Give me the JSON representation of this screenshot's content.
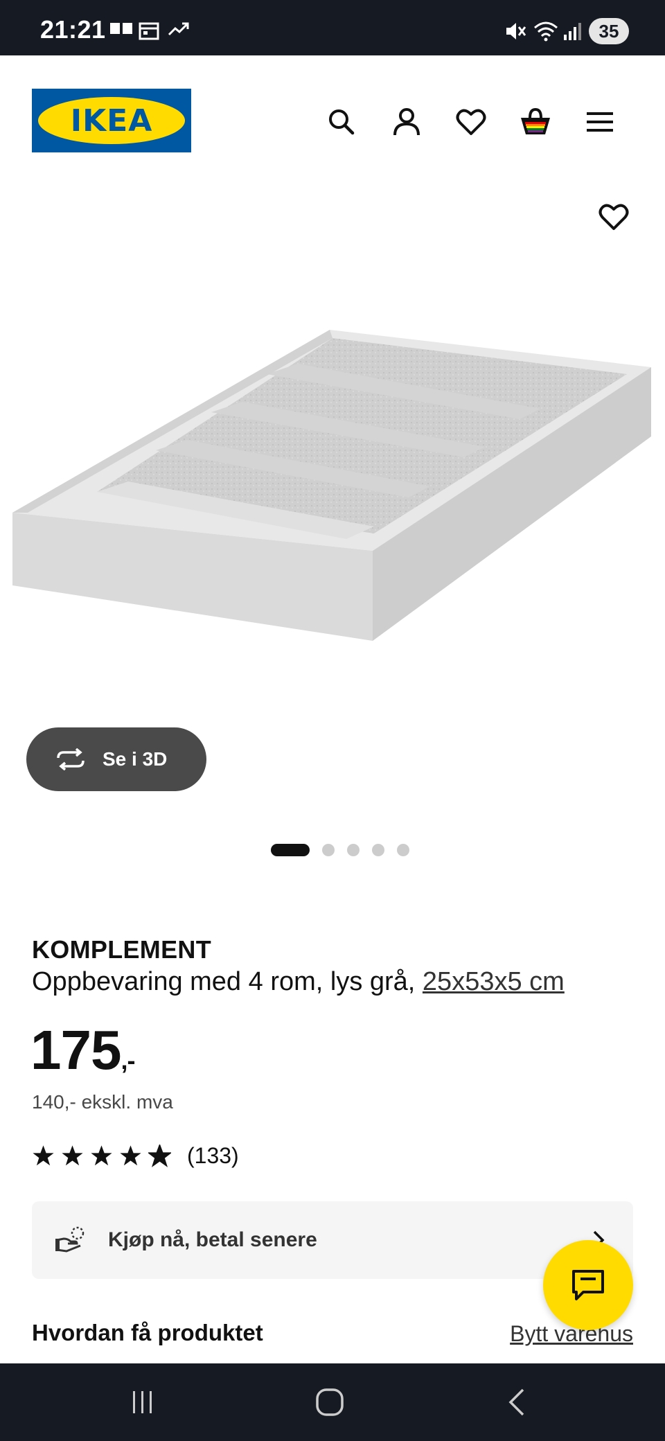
{
  "status_bar": {
    "time": "21:21",
    "battery": "35"
  },
  "header": {
    "logo_text": "IKEA",
    "icons": [
      "search-icon",
      "account-icon",
      "heart-icon",
      "cart-icon",
      "menu-icon"
    ]
  },
  "gallery": {
    "view_3d_label": "Se i 3D",
    "page_count": 5,
    "active_page": 1
  },
  "product": {
    "brand": "KOMPLEMENT",
    "description": "Oppbevaring med 4 rom, lys grå, ",
    "dimensions": "25x53x5 cm",
    "price": "175",
    "price_suffix": ",-",
    "price_ex_vat": "140,- ekskl. mva",
    "rating": 4.5,
    "rating_count": "(133)"
  },
  "bnpl": {
    "label": "Kjøp nå, betal senere"
  },
  "delivery": {
    "heading": "Hvordan få produktet",
    "change_store": "Bytt varehus"
  },
  "colors": {
    "ikea_blue": "#0058a3",
    "ikea_yellow": "#ffdb00",
    "dark_bar": "#151a23"
  }
}
